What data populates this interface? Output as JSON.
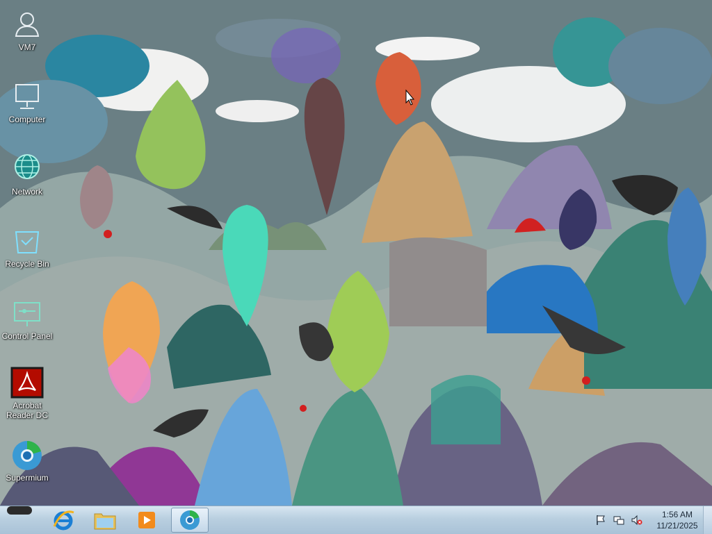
{
  "desktop": {
    "icons": [
      {
        "label": "VM7",
        "icon": "user-icon"
      },
      {
        "label": "Computer",
        "icon": "computer-icon"
      },
      {
        "label": "Network",
        "icon": "network-globe-icon"
      },
      {
        "label": "Recycle Bin",
        "icon": "recycle-bin-icon"
      },
      {
        "label": "Control Panel",
        "icon": "control-panel-icon"
      },
      {
        "label": "Acrobat Reader DC",
        "label_line1": "Acrobat",
        "label_line2": "Reader DC",
        "icon": "acrobat-icon"
      },
      {
        "label": "Supermium",
        "icon": "supermium-browser-icon"
      }
    ]
  },
  "taskbar": {
    "pinned": [
      {
        "name": "internet-explorer",
        "icon": "ie-icon"
      },
      {
        "name": "file-explorer",
        "icon": "folder-icon"
      },
      {
        "name": "media-player",
        "icon": "media-player-icon"
      },
      {
        "name": "supermium",
        "icon": "supermium-browser-icon",
        "active": true
      }
    ],
    "tray": {
      "icons": [
        "flag-icon",
        "network-tray-icon",
        "volume-muted-icon"
      ],
      "time": "1:56 AM",
      "date": "11/21/2025"
    }
  },
  "colors": {
    "taskbar": "#b9cfe0",
    "icon_label": "#ffffff",
    "clock_text": "#1d2a38"
  }
}
